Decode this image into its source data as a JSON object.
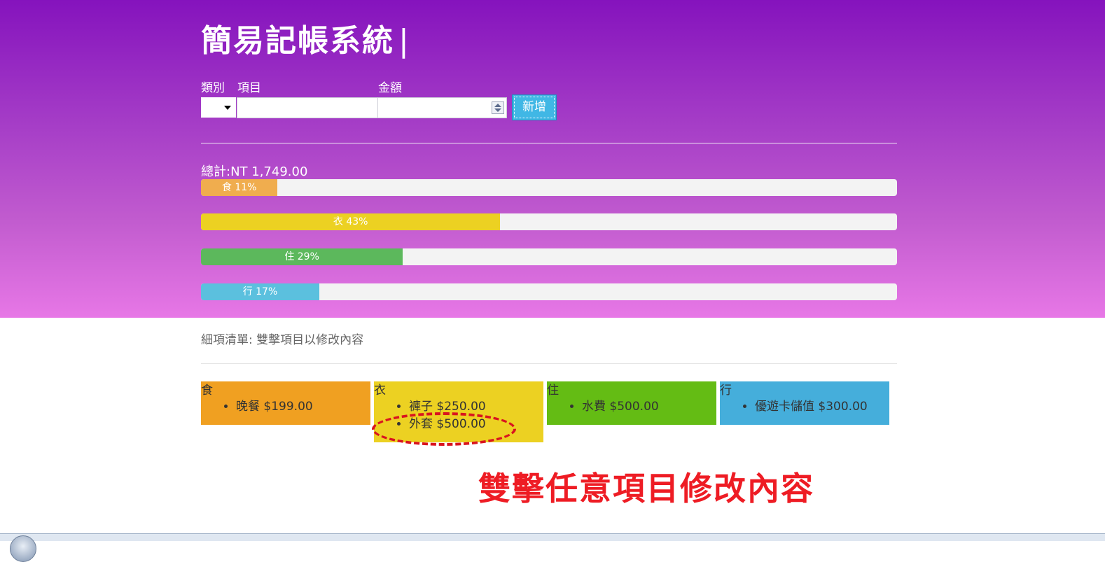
{
  "app": {
    "title": "簡易記帳系統",
    "cursor": "|"
  },
  "form": {
    "category_label": "類別",
    "item_label": "項目",
    "amount_label": "金額",
    "category_value": "",
    "item_value": "",
    "amount_value": "",
    "add_button": "新增"
  },
  "summary": {
    "total": "總計:NT 1,749.00",
    "bars": [
      {
        "label": "食 11%",
        "percent": 11,
        "color": "#f0ad4e"
      },
      {
        "label": "衣 43%",
        "percent": 43,
        "color": "#ecd122"
      },
      {
        "label": "住 29%",
        "percent": 29,
        "color": "#5cb85c"
      },
      {
        "label": "行 17%",
        "percent": 17,
        "color": "#5bc0de"
      }
    ]
  },
  "details": {
    "heading": "細項清單: 雙擊項目以修改內容",
    "categories": [
      {
        "name": "食",
        "color": "#f0a021",
        "items": [
          "晚餐 $199.00"
        ]
      },
      {
        "name": "衣",
        "color": "#ecd122",
        "items": [
          "褲子 $250.00",
          "外套 $500.00"
        ]
      },
      {
        "name": "住",
        "color": "#64bc14",
        "items": [
          "水費 $500.00"
        ]
      },
      {
        "name": "行",
        "color": "#45aedb",
        "items": [
          "優遊卡儲值 $300.00"
        ]
      }
    ]
  },
  "annotation": {
    "caption": "雙擊任意項目修改內容",
    "color": "#ee1c24"
  }
}
